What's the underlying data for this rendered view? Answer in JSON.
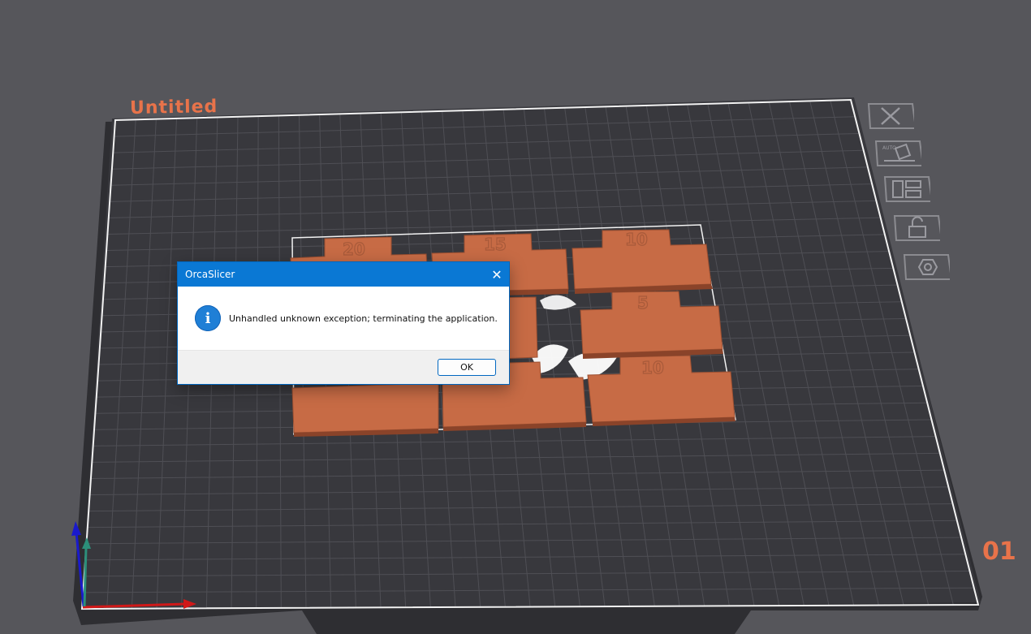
{
  "app": {
    "plate_name": "Untitled",
    "plate_number": "01"
  },
  "toolbar": {
    "items": [
      {
        "name": "delete-plate-button",
        "icon": "close-icon"
      },
      {
        "name": "auto-orient-button",
        "icon": "auto-orient-icon",
        "badge": "AUTO"
      },
      {
        "name": "arrange-button",
        "icon": "arrange-icon"
      },
      {
        "name": "lock-button",
        "icon": "unlock-icon"
      },
      {
        "name": "plate-settings-button",
        "icon": "hexagon-nut-icon"
      }
    ]
  },
  "parts": {
    "labels": [
      "20",
      "15",
      "10",
      "5",
      "10"
    ]
  },
  "dialog": {
    "title": "OrcaSlicer",
    "icon": "info-icon",
    "icon_glyph": "i",
    "close_glyph": "✕",
    "message": "Unhandled unknown exception; terminating the application.",
    "ok_label": "OK"
  },
  "colors": {
    "background": "#56565b",
    "plate": "#38383d",
    "grid": "#4f4f55",
    "part": "#c76b45",
    "accent": "#e8734a",
    "dialog_titlebar": "#0a78d4"
  }
}
